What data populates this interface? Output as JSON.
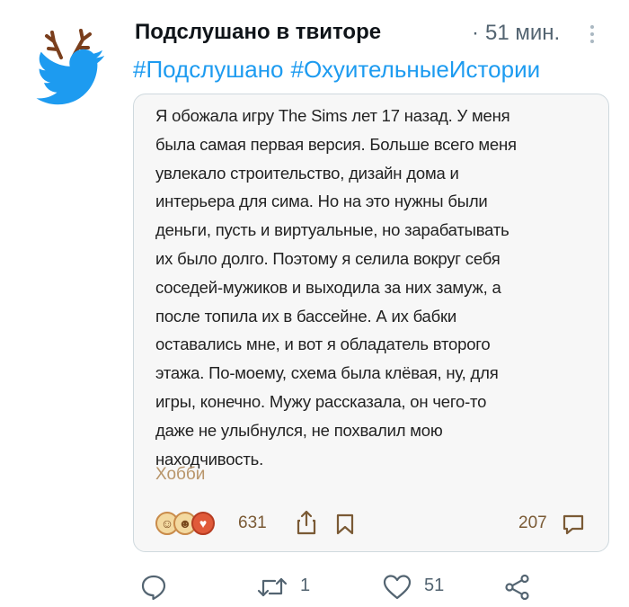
{
  "tweet": {
    "author": "Подслушано в твиторе",
    "separator": "·",
    "time": "51 мин.",
    "hashtags": [
      "#Подслушано",
      "#ОхуительныеИстории"
    ]
  },
  "card": {
    "story": "Я обожала игру The Sims лет 17 назад. У меня была самая первая версия. Больше всего меня увлекало строительство, дизайн дома и интерьера для сима. Но на это нужны были деньги, пусть и виртуальные, но зарабатывать их было долго. Поэтому я селила вокруг себя соседей-мужиков и выходила за них замуж, а после топила их в бассейне. А их бабки оставались мне, и вот я обладатель второго этажа. По-моему, схема была клёвая, ну, для игры, конечно. Мужу рассказала, он чего-то даже не улыбнулся, не похвалил мою находчивость.",
    "story_lines": [
      "Я обожала игру The Sims лет 17 назад. У меня",
      "была самая первая версия. Больше всего меня",
      "увлекало строительство, дизайн дома и",
      "интерьера для сима. Но на это нужны были",
      "деньги, пусть и виртуальные, но зарабатывать",
      "их было долго. Поэтому я селила вокруг себя",
      "соседей-мужиков и выходила за них замуж, а",
      "после топила их в бассейне. А их бабки",
      "оставались мне, и вот я обладатель второго",
      "этажа. По-моему, схема была клёвая, ну, для",
      "игры, конечно. Мужу рассказала, он чего-то",
      "даже не улыбнулся, не похвалил мою",
      "находчивость."
    ],
    "category": "Хобби",
    "reactions_count": "631",
    "comments_count": "207"
  },
  "actions": {
    "reply_count": "",
    "retweet_count": "1",
    "like_count": "51"
  },
  "colors": {
    "twitter_blue": "#1d9bf0",
    "muted_gray": "#536471",
    "card_accent": "#b8956a"
  },
  "icons": {
    "avatar": "twitter-bird-with-antlers",
    "more": "vertical-dots-icon",
    "share": "share-icon",
    "bookmark": "bookmark-icon",
    "comment": "comment-bubble-icon",
    "reply": "reply-icon",
    "retweet": "retweet-icon",
    "like": "heart-icon",
    "tweet_share": "share-nodes-icon"
  }
}
